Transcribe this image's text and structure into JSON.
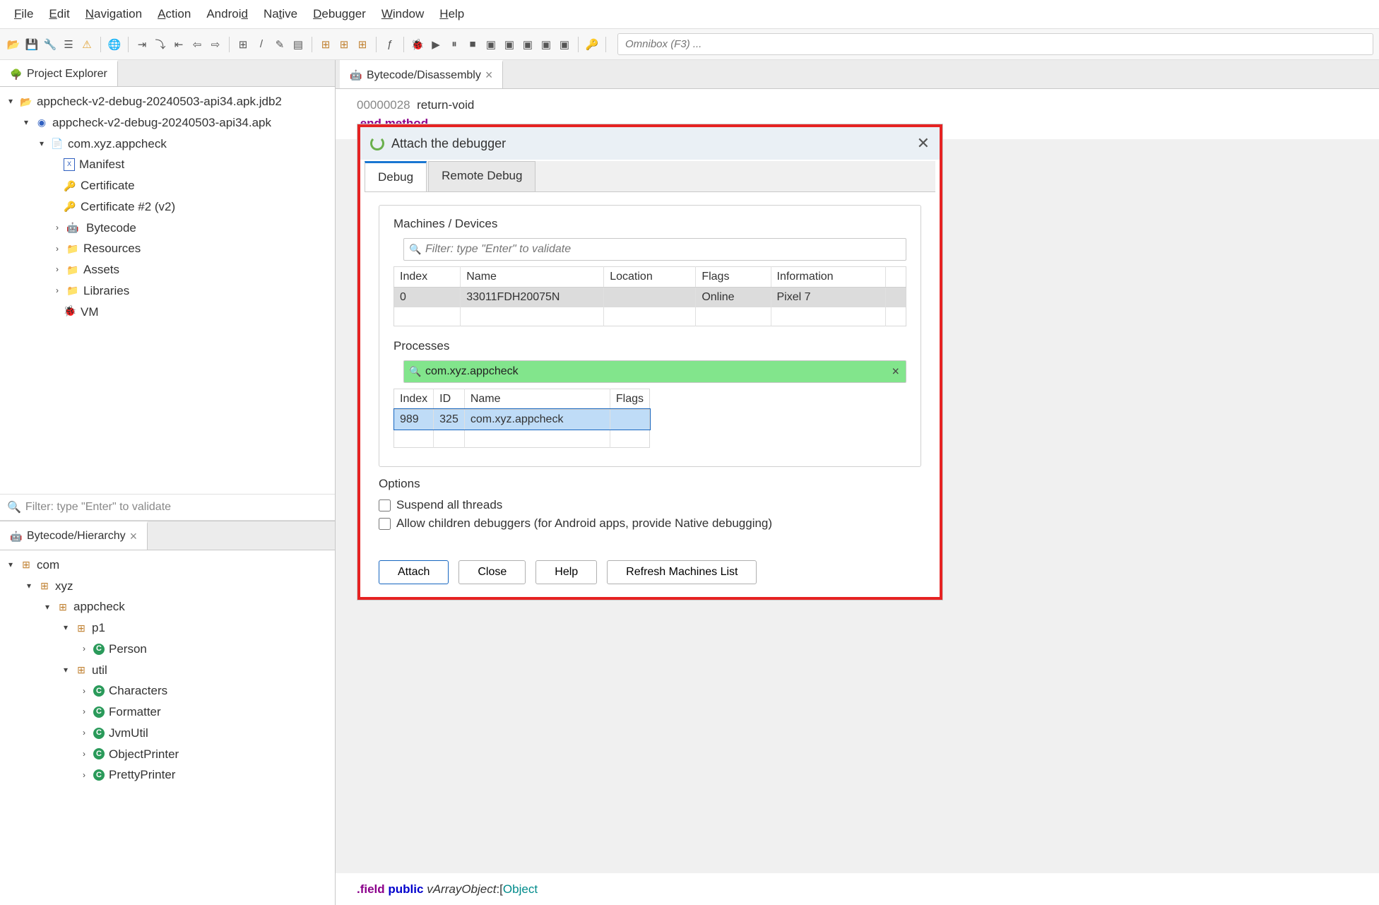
{
  "menubar": [
    "File",
    "Edit",
    "Navigation",
    "Action",
    "Android",
    "Native",
    "Debugger",
    "Window",
    "Help"
  ],
  "omnibox_placeholder": "Omnibox (F3) ...",
  "left_top_tab": "Project Explorer",
  "tree": {
    "root": "appcheck-v2-debug-20240503-api34.apk.jdb2",
    "apk": "appcheck-v2-debug-20240503-api34.apk",
    "pkg": "com.xyz.appcheck",
    "children": [
      "Manifest",
      "Certificate",
      "Certificate #2 (v2)",
      "Bytecode",
      "Resources",
      "Assets",
      "Libraries",
      "VM"
    ]
  },
  "filter_placeholder": "Filter: type \"Enter\" to validate",
  "left_bot_tab": "Bytecode/Hierarchy",
  "hier": {
    "root": "com",
    "l1": "xyz",
    "l2": "appcheck",
    "l3a": "p1",
    "l3a_c": [
      "Person"
    ],
    "l3b": "util",
    "l3b_c": [
      "Characters",
      "Formatter",
      "JvmUtil",
      "ObjectPrinter",
      "PrettyPrinter"
    ]
  },
  "right_tab": "Bytecode/Disassembly",
  "code": {
    "line1_off": "00000028",
    "line1_txt": "return-void",
    "line2_a": ".end",
    "line2_b": "method",
    "line3_a": ".field",
    "line3_b": "public",
    "line3_c": "vArrayObject",
    "line3_d": ":[",
    "line3_e": "Object"
  },
  "dialog": {
    "title": "Attach the debugger",
    "tabs": [
      "Debug",
      "Remote Debug"
    ],
    "machines_label": "Machines / Devices",
    "machines_filter": "Filter: type \"Enter\" to validate",
    "machines_cols": [
      "Index",
      "Name",
      "Location",
      "Flags",
      "Information"
    ],
    "machines_row": {
      "index": "0",
      "name": "33011FDH20075N",
      "loc": "",
      "flags": "Online",
      "info": "Pixel 7"
    },
    "proc_label": "Processes",
    "proc_filter": "com.xyz.appcheck",
    "proc_cols": [
      "Index",
      "ID",
      "Name",
      "Flags"
    ],
    "proc_row": {
      "index": "989",
      "id": "325",
      "name": "com.xyz.appcheck",
      "flags": ""
    },
    "options_label": "Options",
    "opt1": "Suspend all threads",
    "opt2": "Allow children debuggers (for Android apps, provide Native debugging)",
    "btn_attach": "Attach",
    "btn_close": "Close",
    "btn_help": "Help",
    "btn_refresh": "Refresh Machines List"
  }
}
